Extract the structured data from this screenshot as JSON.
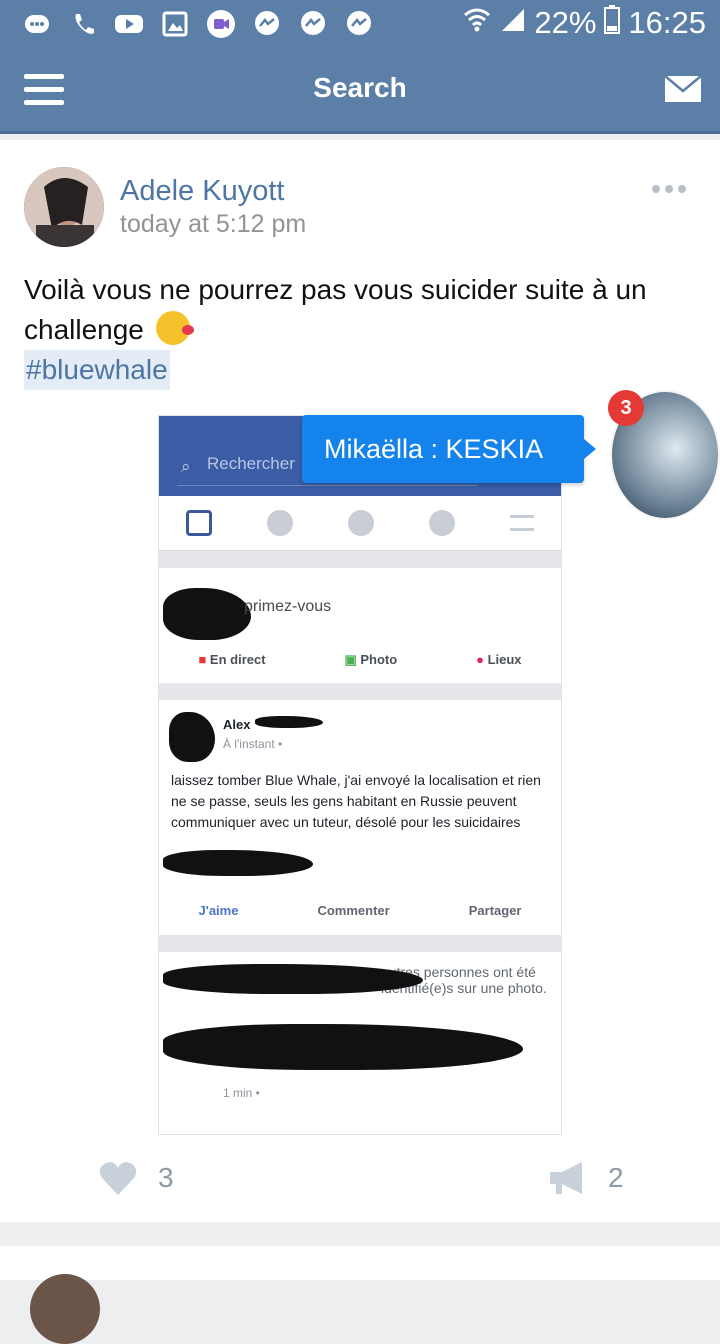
{
  "status_bar": {
    "battery": "22%",
    "time": "16:25",
    "icons": [
      "chat-bubble-icon",
      "phone-icon",
      "youtube-icon",
      "gallery-icon",
      "video-icon",
      "messenger-icon",
      "messenger-icon",
      "messenger-icon",
      "wifi-icon",
      "signal-icon",
      "battery-icon"
    ]
  },
  "navbar": {
    "title": "Search"
  },
  "post": {
    "author": "Adele Kuyott",
    "time": "today at 5:12 pm",
    "text": "Voilà vous ne pourrez pas vous suicider suite à un challenge",
    "hashtag": "#bluewhale",
    "likes": "3",
    "shares": "2"
  },
  "screenshot": {
    "search_placeholder": "Rechercher",
    "status_prompt": "primez-vous",
    "actions": [
      "En direct",
      "Photo",
      "Lieux"
    ],
    "post_author": "Alex",
    "post_time": "À l'instant • ",
    "post_text": "laissez tomber Blue Whale, j'ai envoyé la localisation et rien ne se passe, seuls les gens habitant en Russie peuvent communiquer avec un tuteur, désolé pour les suicidaires",
    "post_actions": [
      "J'aime",
      "Commenter",
      "Partager"
    ],
    "tag_text": "autres personnes ont été identifié(e)s sur une photo.",
    "tag_time": "1 min • "
  },
  "chat_head": {
    "badge": "3",
    "message": "Mikaëlla : KESKIA"
  }
}
